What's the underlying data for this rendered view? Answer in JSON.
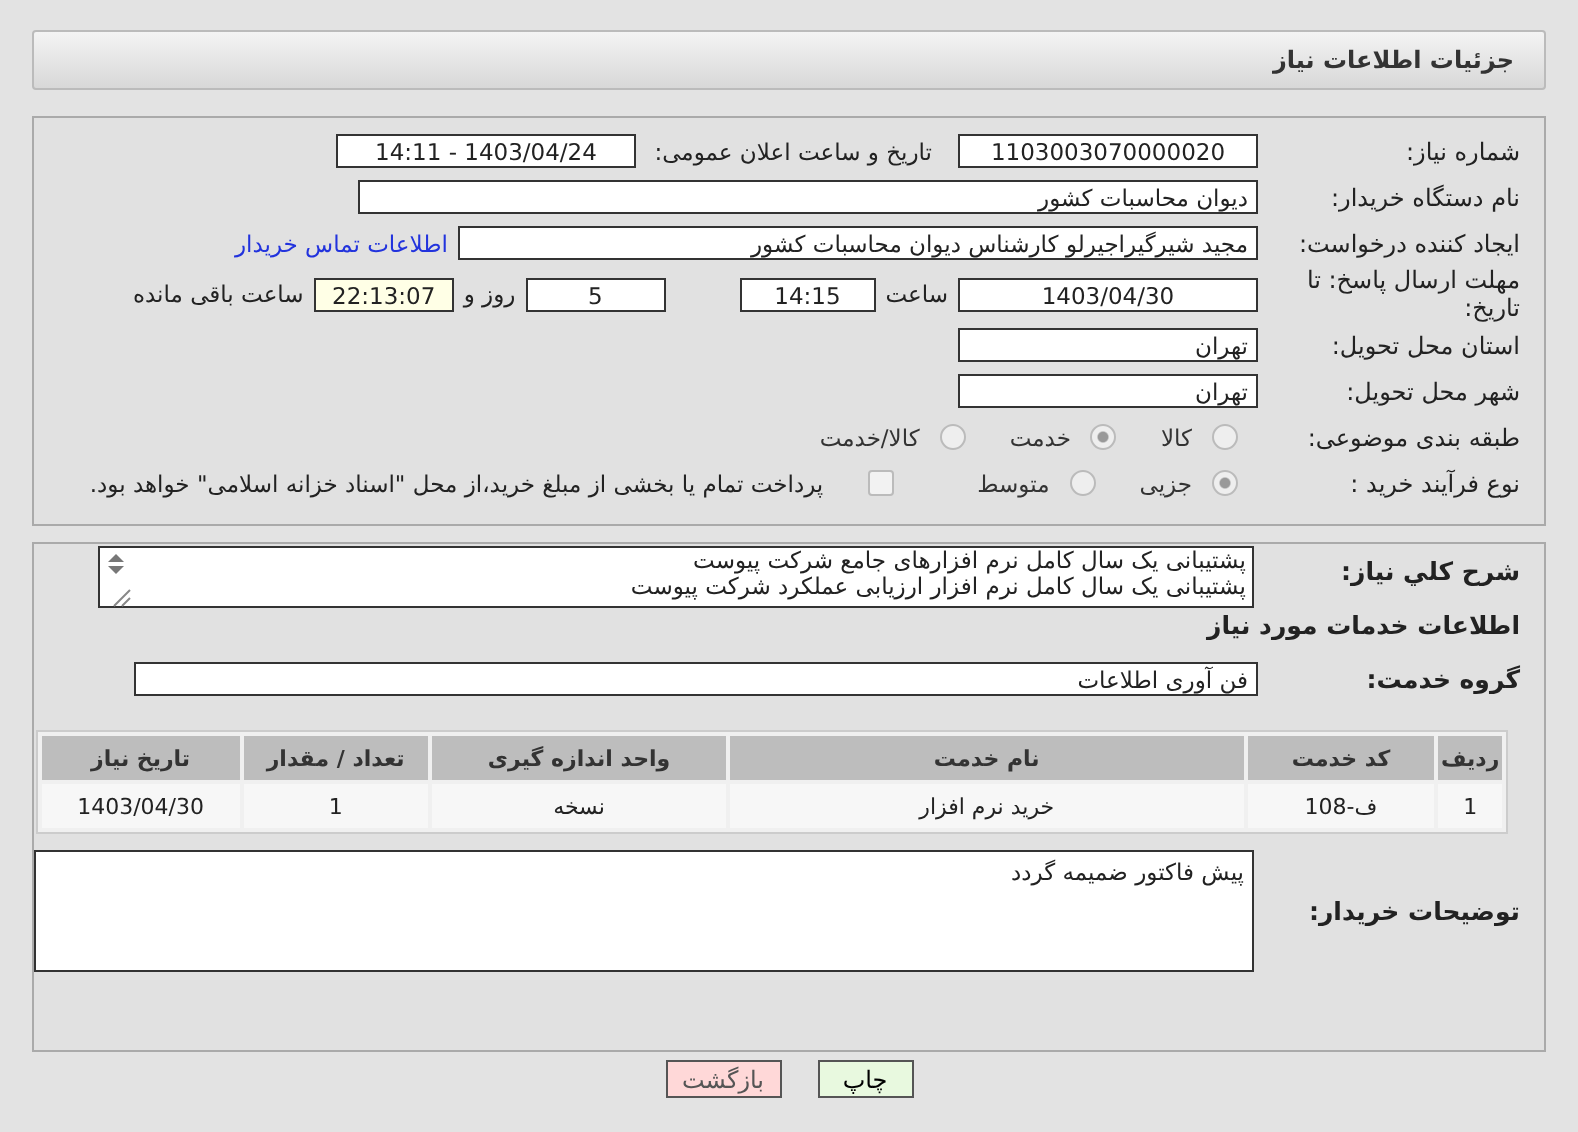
{
  "header": {
    "title": "جزئیات اطلاعات نیاز"
  },
  "details": {
    "need_number": {
      "label": "شماره نیاز:",
      "value": "1103003070000020"
    },
    "announce": {
      "label": "تاریخ و ساعت اعلان عمومی:",
      "value": "1403/04/24 - 14:11"
    },
    "buyer_org": {
      "label": "نام دستگاه خریدار:",
      "value": "دیوان محاسبات کشور"
    },
    "requester": {
      "label": "ایجاد کننده درخواست:",
      "value": "مجید شیرگیراجیرلو کارشناس دیوان محاسبات کشور",
      "link": "اطلاعات تماس خریدار"
    },
    "deadline": {
      "label": "مهلت ارسال پاسخ: تا تاریخ:",
      "date": "1403/04/30",
      "time_label": "ساعت",
      "time": "14:15",
      "days": "5",
      "days_label": "روز و",
      "remaining": "22:13:07",
      "remaining_label": "ساعت باقی مانده"
    },
    "province": {
      "label": "استان محل تحویل:",
      "value": "تهران"
    },
    "city": {
      "label": "شهر محل تحویل:",
      "value": "تهران"
    },
    "category": {
      "label": "طبقه بندی موضوعی:",
      "options": [
        {
          "label": "کالا",
          "selected": false
        },
        {
          "label": "خدمت",
          "selected": true
        },
        {
          "label": "کالا/خدمت",
          "selected": false
        }
      ]
    },
    "process": {
      "label": "نوع فرآیند خرید :",
      "options": [
        {
          "label": "جزیی",
          "selected": true
        },
        {
          "label": "متوسط",
          "selected": false
        }
      ],
      "treasury": {
        "checked": false,
        "label": "پرداخت تمام یا بخشی از مبلغ خرید،از محل \"اسناد خزانه اسلامی\" خواهد بود."
      }
    }
  },
  "services": {
    "summary": {
      "label": "شرح کلي نياز:",
      "lines": [
        "پشتیبانی یک سال کامل نرم افزارهای جامع شرکت پیوست",
        "پشتیبانی یک سال کامل نرم افزار ارزیابی عملکرد شرکت پیوست"
      ]
    },
    "heading": "اطلاعات خدمات مورد نیاز",
    "group": {
      "label": "گروه خدمت:",
      "value": "فن آوری اطلاعات"
    },
    "table": {
      "columns": [
        "ردیف",
        "کد خدمت",
        "نام خدمت",
        "واحد اندازه گیری",
        "تعداد / مقدار",
        "تاریخ نیاز"
      ],
      "rows": [
        [
          "1",
          "ف-108",
          "خرید نرم افزار",
          "نسخه",
          "1",
          "1403/04/30"
        ]
      ]
    },
    "notes": {
      "label": "توضیحات خریدار:",
      "value": "پیش فاکتور ضمیمه گردد"
    }
  },
  "buttons": [
    {
      "label": "چاپ",
      "kind": "print"
    },
    {
      "label": "بازگشت",
      "kind": "back"
    }
  ]
}
